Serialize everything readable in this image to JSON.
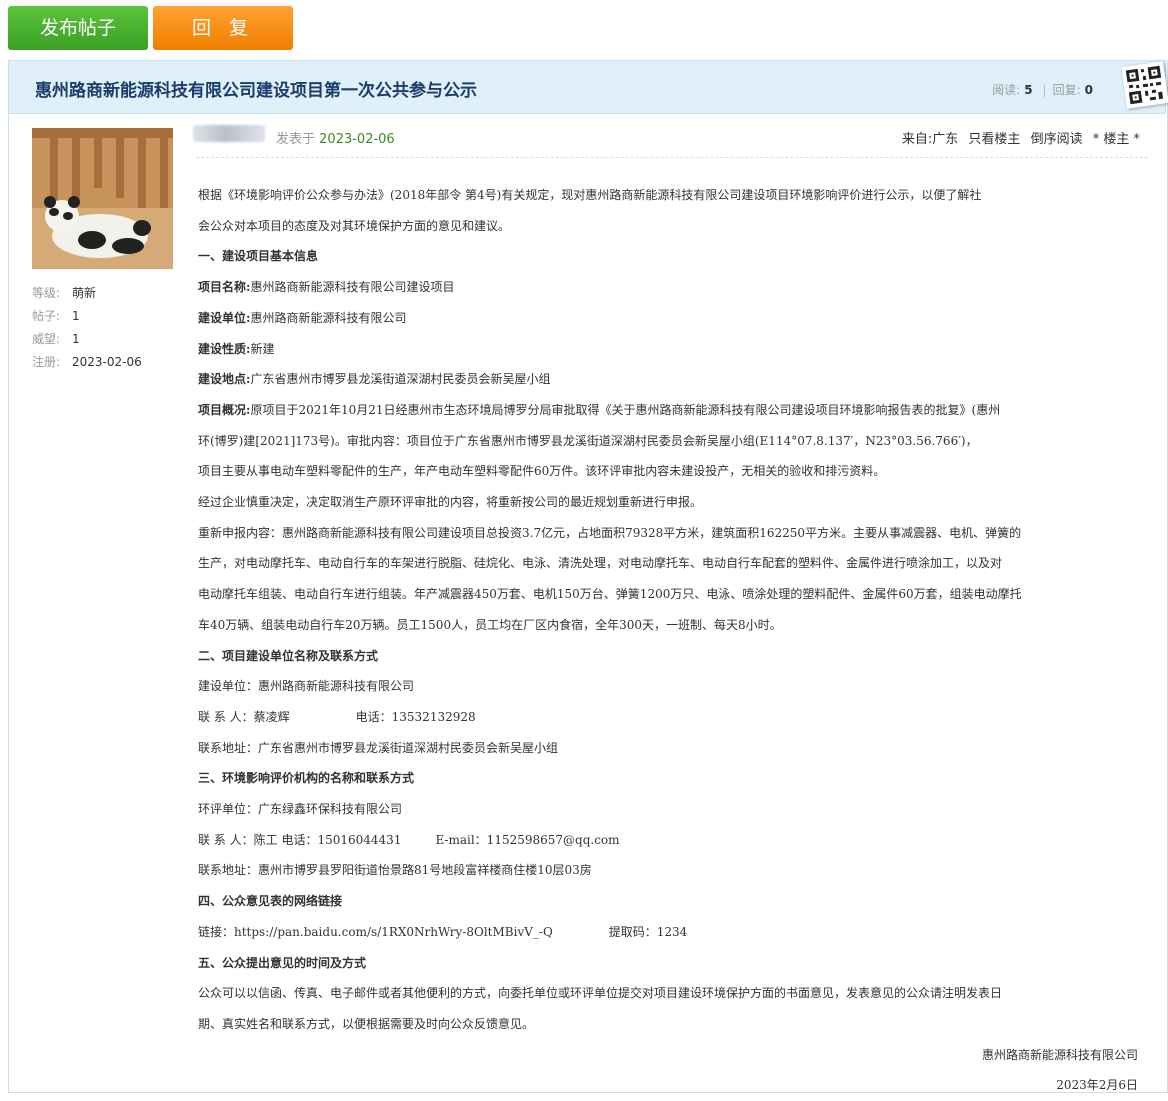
{
  "toolbar": {
    "post_label": "发布帖子",
    "reply_label": "回 复"
  },
  "thread": {
    "title": "惠州路商新能源科技有限公司建设项目第一次公共参与公示",
    "views_label": "阅读:",
    "views": "5",
    "replies_label": "回复:",
    "replies": "0"
  },
  "author": {
    "level_label": "等级:",
    "level": "萌新",
    "posts_label": "帖子:",
    "posts": "1",
    "prestige_label": "威望:",
    "prestige": "1",
    "reg_label": "注册:",
    "reg": "2023-02-06"
  },
  "post": {
    "posted_prefix": "发表于",
    "posted_date": "2023-02-06",
    "from": "来自:广东",
    "only_author": "只看楼主",
    "reverse": "倒序阅读",
    "floor": "* 楼主 *"
  },
  "content": {
    "intro1": "根据《环境影响评价公众参与办法》(2018年部令 第4号)有关规定，现对惠州路商新能源科技有限公司建设项目环境影响评价进行公示，以便了解社",
    "intro2": "会公众对本项目的态度及对其环境保护方面的意见和建议。",
    "s1": "一、建设项目基本信息",
    "name_k": "项目名称:",
    "name_v": "惠州路商新能源科技有限公司建设项目",
    "unit_k": "建设单位:",
    "unit_v": "惠州路商新能源科技有限公司",
    "nature_k": "建设性质:",
    "nature_v": "新建",
    "site_k": "建设地点:",
    "site_v": "广东省惠州市博罗县龙溪街道深湖村民委员会新吴屋小组",
    "ov_k": "项目概况:",
    "ov1": "原项目于2021年10月21日经惠州市生态环境局博罗分局审批取得《关于惠州路商新能源科技有限公司建设项目环境影响报告表的批复》(惠州",
    "ov2": "环(博罗)建[2021]173号)。审批内容：项目位于广东省惠州市博罗县龙溪街道深湖村民委员会新吴屋小组(E114°07.8.137′，N23°03.56.766′)，",
    "ov3": "项目主要从事电动车塑料零配件的生产，年产电动车塑料零配件60万件。该环评审批内容未建设投产，无相关的验收和排污资料。",
    "ov4": "经过企业慎重决定，决定取消生产原环评审批的内容，将重新按公司的最近规划重新进行申报。",
    "re1": "重新申报内容：惠州路商新能源科技有限公司建设项目总投资3.7亿元，占地面积79328平方米，建筑面积162250平方米。主要从事减震器、电机、弹簧的",
    "re2": "生产，对电动摩托车、电动自行车的车架进行脱脂、硅烷化、电泳、清洗处理，对电动摩托车、电动自行车配套的塑料件、金属件进行喷涂加工，以及对",
    "re3": "电动摩托车组装、电动自行车进行组装。年产减震器450万套、电机150万台、弹簧1200万只、电泳、喷涂处理的塑料配件、金属件60万套，组装电动摩托",
    "re4": "车40万辆、组装电动自行车20万辆。员工1500人，员工均在厂区内食宿，全年300天，一班制、每天8小时。",
    "s2": "二、项目建设单位名称及联系方式",
    "c_unit": "建设单位：惠州路商新能源科技有限公司",
    "c_person": "联 系 人：蔡凌辉",
    "c_phone": "电话：13532132928",
    "c_addr": "联系地址：广东省惠州市博罗县龙溪街道深湖村民委员会新吴屋小组",
    "s3": "三、环境影响评价机构的名称和联系方式",
    "e_unit": "环评单位：广东绿鑫环保科技有限公司",
    "e_person": "联 系 人：陈工  电话：15016044431",
    "e_mail": "E-mail：1152598657@qq.com",
    "e_addr": "联系地址：惠州市博罗县罗阳街道怡景路81号地段富祥楼商住楼10层03房",
    "s4": "四、公众意见表的网络链接",
    "link": "链接：https://pan.baidu.com/s/1RX0NrhWry-8OltMBivV_-Q",
    "code": "提取码：1234",
    "s5": "五、公众提出意见的时间及方式",
    "m1": "公众可以以信函、传真、电子邮件或者其他便利的方式，向委托单位或环评单位提交对项目建设环境保护方面的书面意见，发表意见的公众请注明发表日",
    "m2": "期、真实姓名和联系方式，以便根据需要及时向公众反馈意见。",
    "sign": "惠州路商新能源科技有限公司",
    "date": "2023年2月6日"
  }
}
